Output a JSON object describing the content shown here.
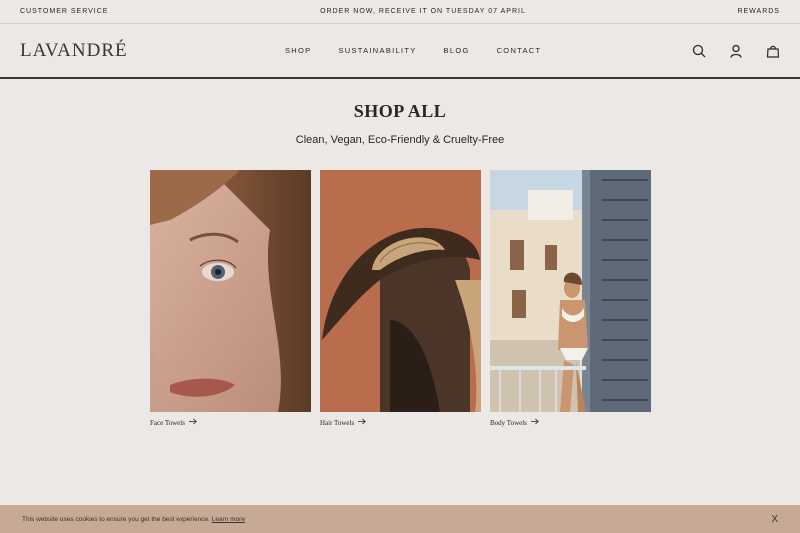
{
  "topbar": {
    "left": "CUSTOMER SERVICE",
    "center": "ORDER NOW, RECEIVE IT  ON TUESDAY 07 APRIL",
    "right": "REWARDS"
  },
  "header": {
    "logo": "LAVANDRÉ",
    "nav": [
      "SHOP",
      "SUSTAINABILITY",
      "BLOG",
      "CONTACT"
    ],
    "icons": [
      "search-icon",
      "account-icon",
      "bag-icon"
    ]
  },
  "main": {
    "title": "SHOP ALL",
    "subtitle": "Clean, Vegan, Eco-Friendly & Cruelty-Free",
    "products": [
      {
        "label": "Face Towels",
        "image": "face-portrait-image"
      },
      {
        "label": "Hair Towels",
        "image": "hat-silhouette-image"
      },
      {
        "label": "Body Towels",
        "image": "balcony-woman-image"
      }
    ]
  },
  "cookie": {
    "text": "This website uses cookies to ensure you get the best experience.",
    "link": "Learn more",
    "close": "X"
  },
  "colors": {
    "background": "#ece8e5",
    "cookie_bar": "#c6aa95",
    "text": "#2a2624"
  }
}
